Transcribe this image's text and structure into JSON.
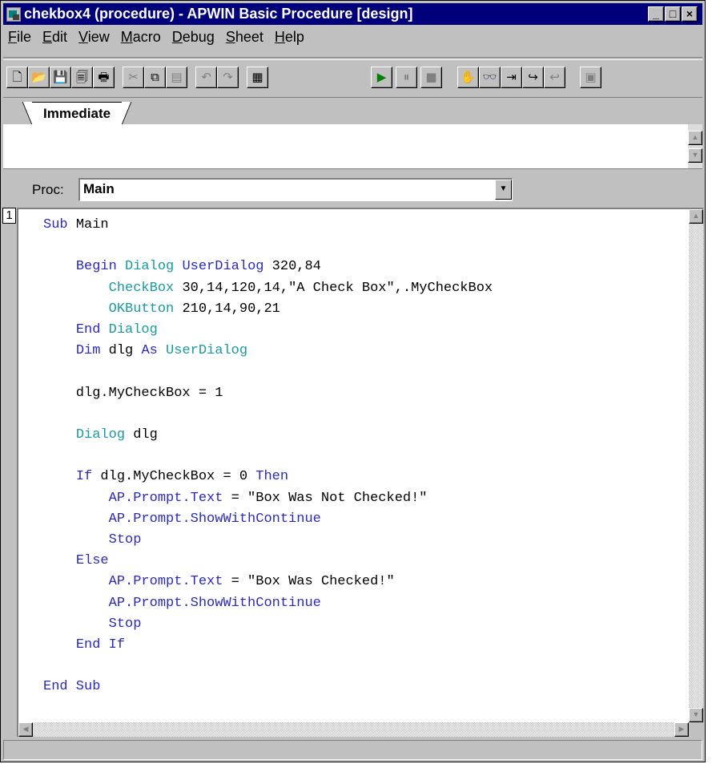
{
  "window": {
    "title": "chekbox4 (procedure) - APWIN Basic Procedure [design]",
    "caption_buttons": [
      "_",
      "□",
      "×"
    ]
  },
  "menu": [
    {
      "key": "F",
      "rest": "ile"
    },
    {
      "key": "E",
      "rest": "dit"
    },
    {
      "key": "V",
      "rest": "iew"
    },
    {
      "key": "M",
      "rest": "acro"
    },
    {
      "key": "D",
      "rest": "ebug"
    },
    {
      "key": "S",
      "rest": "heet"
    },
    {
      "key": "H",
      "rest": "elp"
    }
  ],
  "toolbar": {
    "buttons": [
      {
        "icon": "new-icon",
        "glyph": "🗋"
      },
      {
        "icon": "open-icon",
        "glyph": "📂"
      },
      {
        "icon": "save-icon",
        "glyph": "💾"
      },
      {
        "icon": "save-all-icon",
        "glyph": "🗐"
      },
      {
        "icon": "print-icon",
        "glyph": "🖶"
      },
      {
        "icon": "cut-icon",
        "glyph": "✂"
      },
      {
        "icon": "copy-icon",
        "glyph": "⧉"
      },
      {
        "icon": "paste-icon",
        "glyph": "▤"
      },
      {
        "icon": "undo-icon",
        "glyph": "↶"
      },
      {
        "icon": "redo-icon",
        "glyph": "↷"
      },
      {
        "icon": "dialog-editor-icon",
        "glyph": "▦"
      },
      {
        "icon": "run-icon",
        "glyph": "▶"
      },
      {
        "icon": "pause-icon",
        "glyph": "⏸"
      },
      {
        "icon": "stop-icon",
        "glyph": "■"
      },
      {
        "icon": "hand-icon",
        "glyph": "✋"
      },
      {
        "icon": "watch-icon",
        "glyph": "👓"
      },
      {
        "icon": "step-into-icon",
        "glyph": "⇥"
      },
      {
        "icon": "step-over-icon",
        "glyph": "↪"
      },
      {
        "icon": "step-out-icon",
        "glyph": "↩"
      },
      {
        "icon": "references-icon",
        "glyph": "▣"
      }
    ]
  },
  "tabs": {
    "immediate": "Immediate"
  },
  "proc": {
    "label": "Proc:",
    "value": "Main"
  },
  "editor": {
    "line_number": "1",
    "code": [
      [
        {
          "t": "kw",
          "v": "Sub "
        },
        {
          "t": "st",
          "v": "Main"
        }
      ],
      [],
      [
        {
          "t": "st",
          "v": "    "
        },
        {
          "t": "kw",
          "v": "Begin "
        },
        {
          "t": "ob",
          "v": "Dialog "
        },
        {
          "t": "kw",
          "v": "UserDialog "
        },
        {
          "t": "st",
          "v": "320,84"
        }
      ],
      [
        {
          "t": "st",
          "v": "        "
        },
        {
          "t": "ob",
          "v": "CheckBox "
        },
        {
          "t": "st",
          "v": "30,14,120,14,\"A Check Box\",.MyCheckBox"
        }
      ],
      [
        {
          "t": "st",
          "v": "        "
        },
        {
          "t": "ob",
          "v": "OKButton "
        },
        {
          "t": "st",
          "v": "210,14,90,21"
        }
      ],
      [
        {
          "t": "st",
          "v": "    "
        },
        {
          "t": "kw",
          "v": "End "
        },
        {
          "t": "ob",
          "v": "Dialog"
        }
      ],
      [
        {
          "t": "st",
          "v": "    "
        },
        {
          "t": "kw",
          "v": "Dim "
        },
        {
          "t": "st",
          "v": "dlg "
        },
        {
          "t": "kw",
          "v": "As "
        },
        {
          "t": "ob",
          "v": "UserDialog"
        }
      ],
      [],
      [
        {
          "t": "st",
          "v": "    dlg.MyCheckBox = 1"
        }
      ],
      [],
      [
        {
          "t": "st",
          "v": "    "
        },
        {
          "t": "ob",
          "v": "Dialog "
        },
        {
          "t": "st",
          "v": "dlg"
        }
      ],
      [],
      [
        {
          "t": "st",
          "v": "    "
        },
        {
          "t": "kw",
          "v": "If "
        },
        {
          "t": "st",
          "v": "dlg.MyCheckBox = 0 "
        },
        {
          "t": "kw",
          "v": "Then"
        }
      ],
      [
        {
          "t": "st",
          "v": "        "
        },
        {
          "t": "kw",
          "v": "AP.Prompt.Text"
        },
        {
          "t": "st",
          "v": " = \"Box Was Not Checked!\""
        }
      ],
      [
        {
          "t": "st",
          "v": "        "
        },
        {
          "t": "kw",
          "v": "AP.Prompt.ShowWithContinue"
        }
      ],
      [
        {
          "t": "st",
          "v": "        "
        },
        {
          "t": "kw",
          "v": "Stop"
        }
      ],
      [
        {
          "t": "st",
          "v": "    "
        },
        {
          "t": "kw",
          "v": "Else"
        }
      ],
      [
        {
          "t": "st",
          "v": "        "
        },
        {
          "t": "kw",
          "v": "AP.Prompt.Text"
        },
        {
          "t": "st",
          "v": " = \"Box Was Checked!\""
        }
      ],
      [
        {
          "t": "st",
          "v": "        "
        },
        {
          "t": "kw",
          "v": "AP.Prompt.ShowWithContinue"
        }
      ],
      [
        {
          "t": "st",
          "v": "        "
        },
        {
          "t": "kw",
          "v": "Stop"
        }
      ],
      [
        {
          "t": "st",
          "v": "    "
        },
        {
          "t": "kw",
          "v": "End If"
        }
      ],
      [],
      [
        {
          "t": "kw",
          "v": "End Sub"
        }
      ]
    ]
  },
  "colors": {
    "titlebar": "#00007b",
    "keyword": "#2b2bb8",
    "object": "#1a9aa0",
    "chrome": "#c0c0c0"
  }
}
